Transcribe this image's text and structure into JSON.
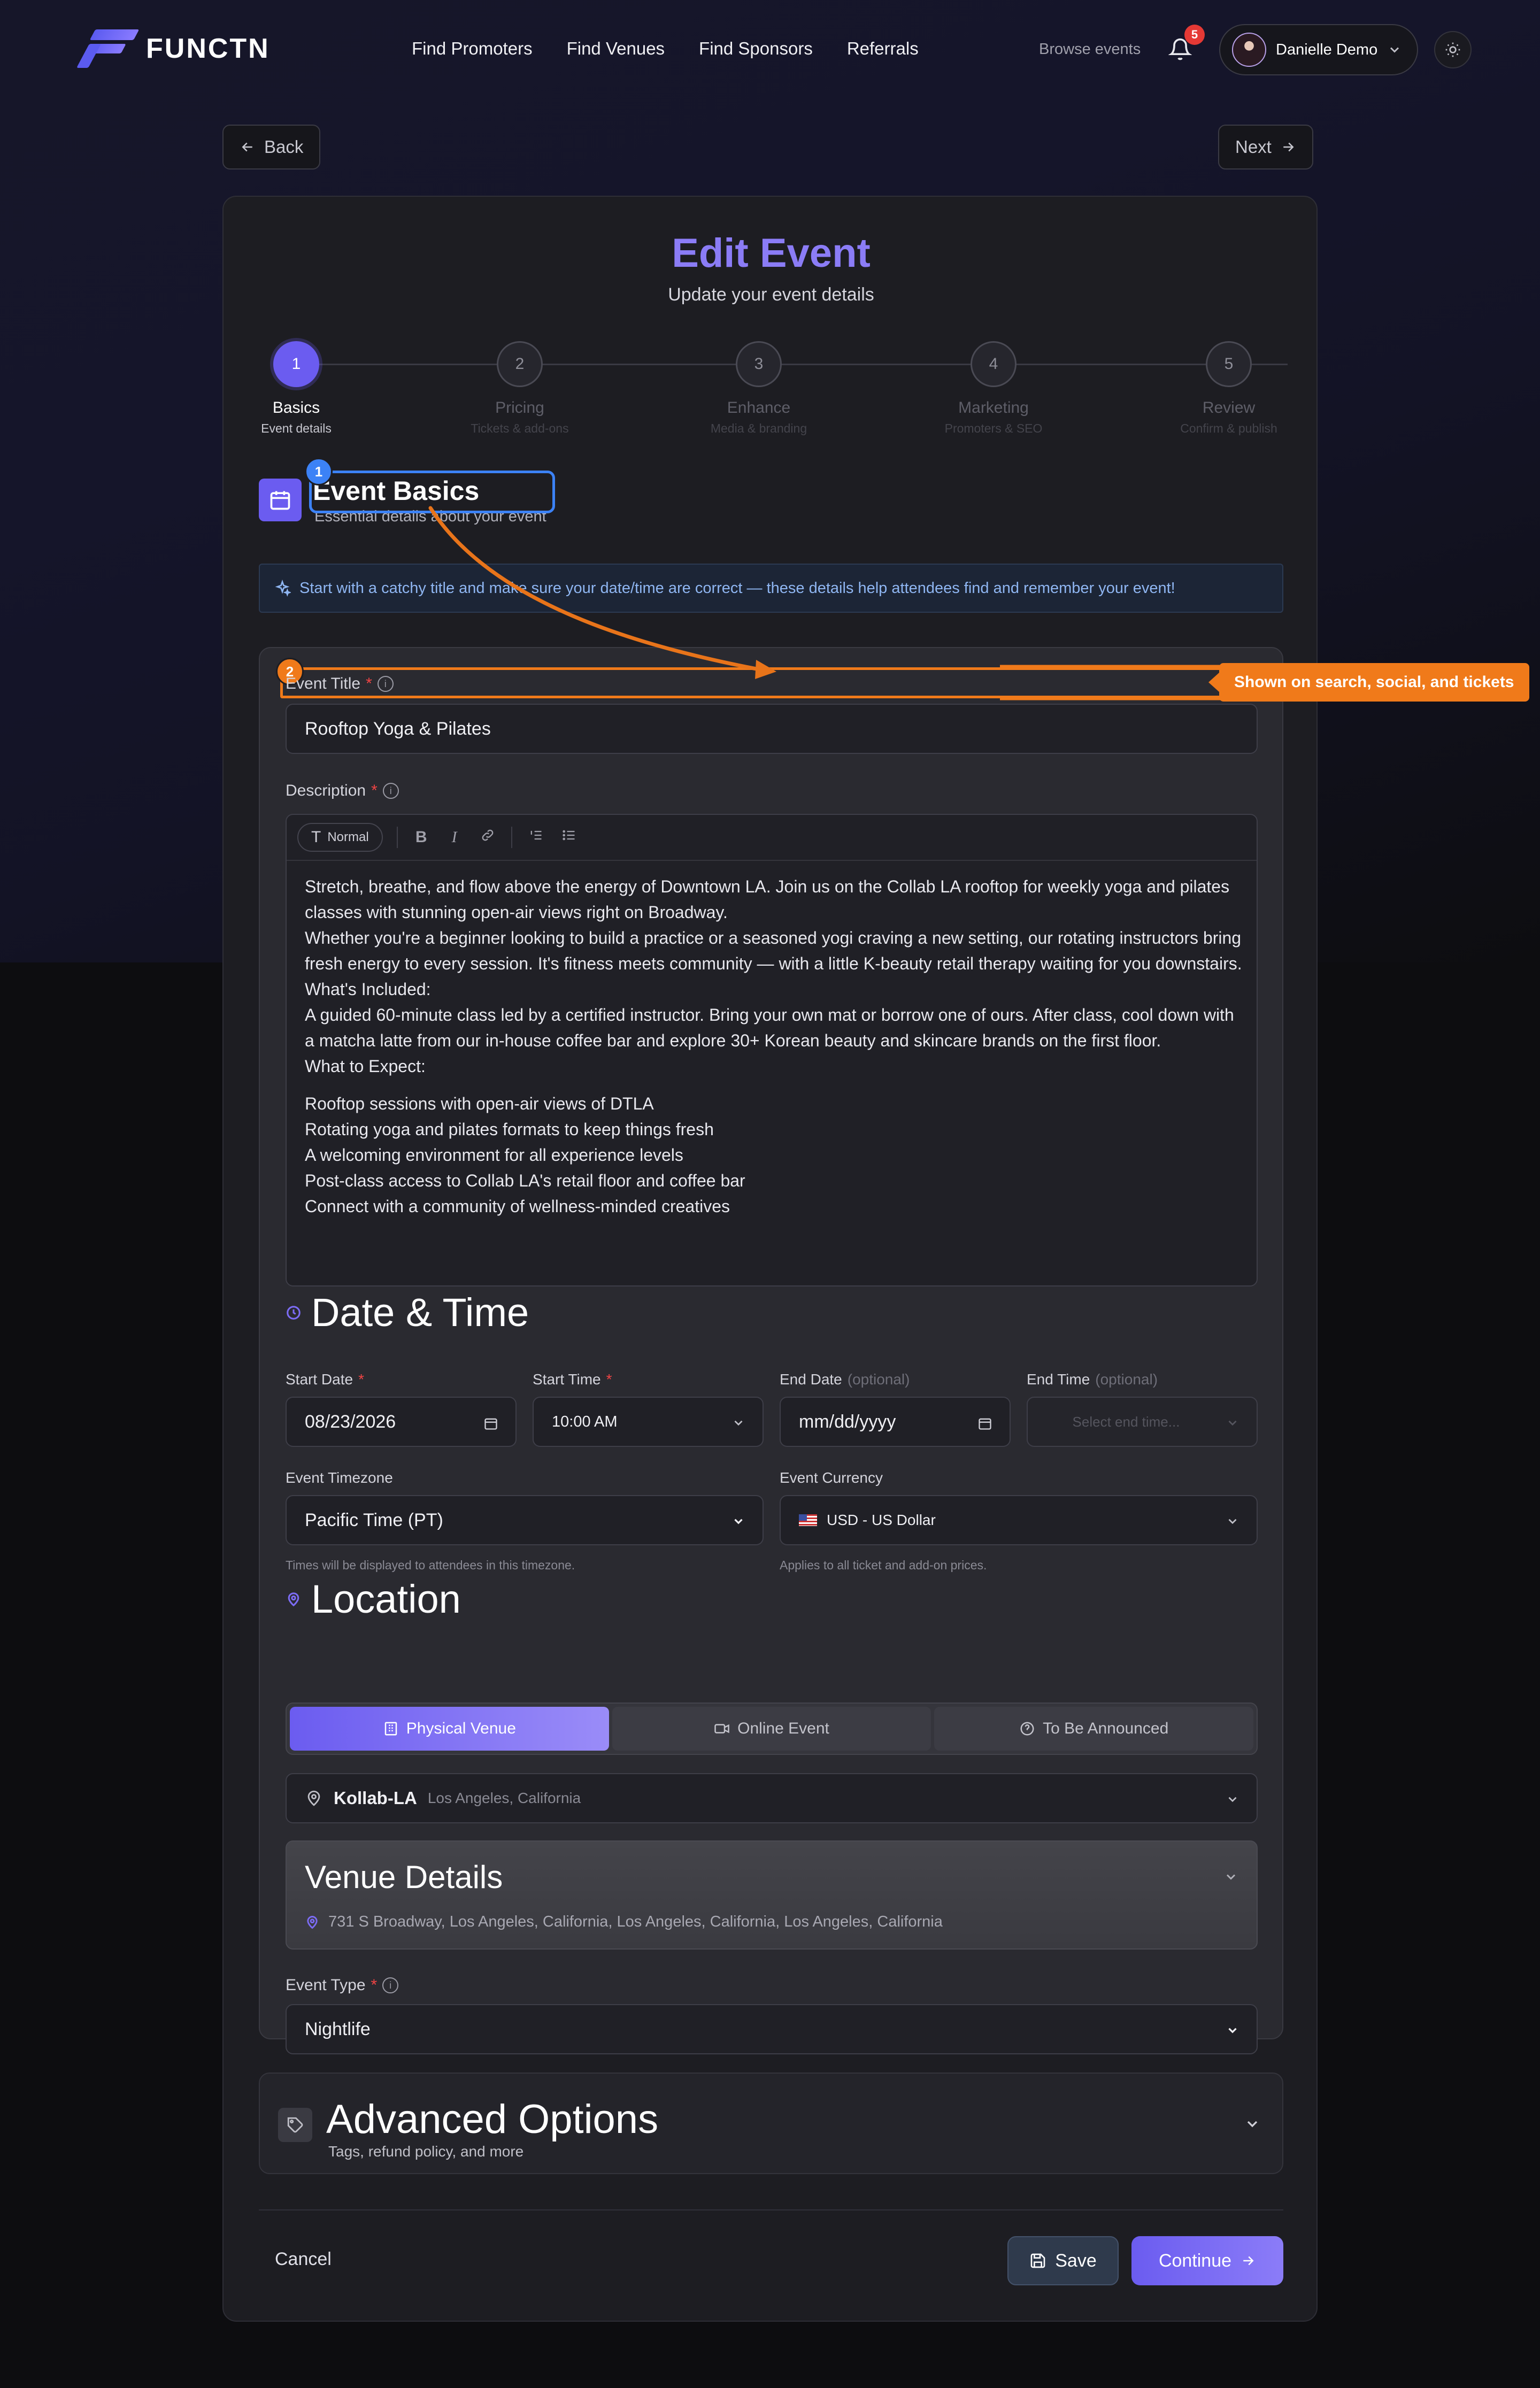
{
  "nav": {
    "logo_text": "FUNCTN",
    "links": [
      "Find Promoters",
      "Find Venues",
      "Find Sponsors",
      "Referrals"
    ],
    "browse": "Browse events",
    "notif_count": "5",
    "user_name": "Danielle Demo"
  },
  "top": {
    "back": "Back",
    "next": "Next"
  },
  "header": {
    "title": "Edit Event",
    "subtitle": "Update your event details"
  },
  "steps": [
    {
      "num": "1",
      "label": "Basics",
      "sub": "Event details",
      "active": true
    },
    {
      "num": "2",
      "label": "Pricing",
      "sub": "Tickets & add-ons"
    },
    {
      "num": "3",
      "label": "Enhance",
      "sub": "Media & branding"
    },
    {
      "num": "4",
      "label": "Marketing",
      "sub": "Promoters & SEO"
    },
    {
      "num": "5",
      "label": "Review",
      "sub": "Confirm & publish"
    }
  ],
  "section": {
    "title": "Event Basics",
    "subtitle": "Essential details about your event"
  },
  "tip": "Start with a catchy title and make sure your date/time are correct — these details help attendees find and remember your event!",
  "annotations": {
    "marker1": "1",
    "marker2": "2",
    "callout": "Shown on search, social, and tickets"
  },
  "form": {
    "title_label": "Event Title",
    "title_value": "Rooftop Yoga & Pilates",
    "desc_label": "Description",
    "toolbar_normal": "Normal",
    "description": {
      "p1": "Stretch, breathe, and flow above the energy of Downtown LA. Join us on the Collab LA rooftop for weekly yoga and pilates classes with stunning open-air views right on Broadway.",
      "p2": "Whether you're a beginner looking to build a practice or a seasoned yogi craving a new setting, our rotating instructors bring fresh energy to every session. It's fitness meets community — with a little K-beauty retail therapy waiting for you downstairs.",
      "p3": "What's Included:",
      "p4": "A guided 60-minute class led by a certified instructor. Bring your own mat or borrow one of ours. After class, cool down with a matcha latte from our in-house coffee bar and explore 30+ Korean beauty and skincare brands on the first floor.",
      "p5": "What to Expect:",
      "b1": "Rooftop sessions with open-air views of DTLA",
      "b2": "Rotating yoga and pilates formats to keep things fresh",
      "b3": "A welcoming environment for all experience levels",
      "b4": "Post-class access to Collab LA's retail floor and coffee bar",
      "b5": "Connect with a community of wellness-minded creatives"
    },
    "datetime": {
      "heading": "Date & Time",
      "start_date_label": "Start Date",
      "start_date": "08/23/2026",
      "start_time_label": "Start Time",
      "start_time": "10:00 AM",
      "end_date_label": "End Date",
      "end_date_placeholder": "mm/dd/yyyy",
      "end_time_label": "End Time",
      "end_time_placeholder": "Select end time...",
      "optional": "(optional)",
      "tz_label": "Event Timezone",
      "tz_value": "Pacific Time (PT)",
      "tz_note": "Times will be displayed to attendees in this timezone.",
      "cur_label": "Event Currency",
      "cur_value": "USD - US Dollar",
      "cur_note": "Applies to all ticket and add-on prices."
    },
    "location": {
      "heading": "Location",
      "tabs": [
        "Physical Venue",
        "Online Event",
        "To Be Announced"
      ],
      "venue_name": "Kollab-LA",
      "venue_city": "Los Angeles, California",
      "details_title": "Venue Details",
      "details_addr": "731 S Broadway, Los Angeles, California, Los Angeles, California, Los Angeles, California"
    },
    "type_label": "Event Type",
    "type_value": "Nightlife"
  },
  "advanced": {
    "title": "Advanced Options",
    "subtitle": "Tags, refund policy, and more"
  },
  "footer": {
    "cancel": "Cancel",
    "save": "Save",
    "continue": "Continue"
  },
  "colors": {
    "accent": "#6b5cf0",
    "title": "#8b7cf6",
    "annotation": "#f07a1a",
    "highlight": "#3c82f6"
  }
}
